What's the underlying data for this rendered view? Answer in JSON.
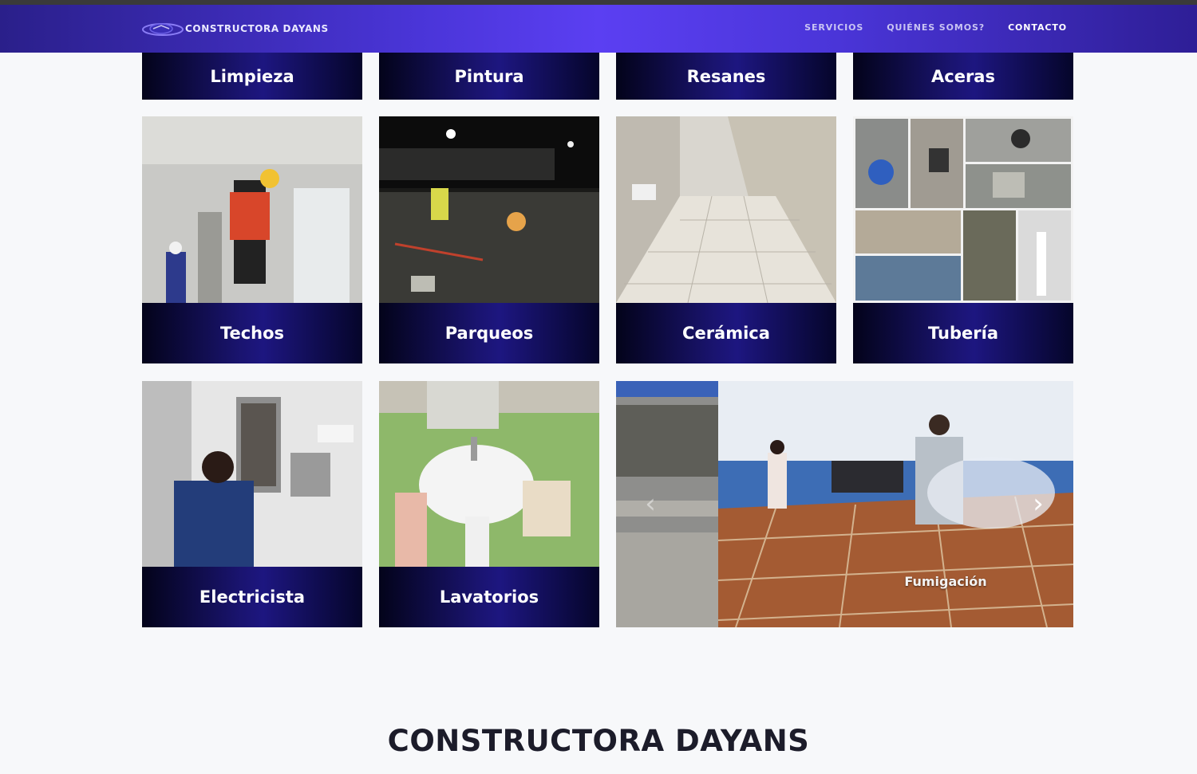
{
  "nav": {
    "brand": "CONSTRUCTORA DAYANS",
    "links": [
      {
        "label": "SERVICIOS"
      },
      {
        "label": "QUIÉNES SOMOS?"
      },
      {
        "label": "CONTACTO"
      }
    ]
  },
  "services_top": [
    "Limpieza",
    "Pintura",
    "Resanes",
    "Aceras"
  ],
  "services_mid": [
    "Techos",
    "Parqueos",
    "Cerámica",
    "Tubería"
  ],
  "services_bottom": [
    "Electricista",
    "Lavatorios"
  ],
  "carousel": {
    "caption": "Fumigación",
    "prev_icon": "chevron-left-icon",
    "next_icon": "chevron-right-icon"
  },
  "about": {
    "title": "CONSTRUCTORA DAYANS"
  },
  "colors": {
    "nav_start": "#2a1f8a",
    "nav_mid": "#5b3ff2",
    "label_dark": "#03031a",
    "label_mid": "#1d1680",
    "page_bg": "#f7f8fa"
  }
}
